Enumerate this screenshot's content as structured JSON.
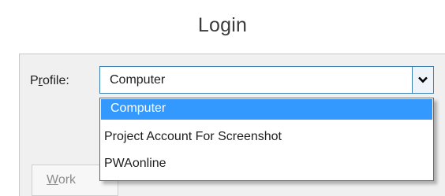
{
  "window": {
    "title": "Login"
  },
  "profile": {
    "label_prefix": "P",
    "label_accel": "r",
    "label_suffix": "ofile:",
    "selected": "Computer",
    "options": [
      "Computer",
      "Project Account For Screenshot",
      "PWAonline"
    ],
    "highlighted_index": 0,
    "dropdown_icon": "chevron-down-icon"
  },
  "tabs": {
    "work_accel": "W",
    "work_rest": "ork"
  },
  "colors": {
    "highlight": "#3399ff",
    "focus_border": "#3c7fb1"
  }
}
